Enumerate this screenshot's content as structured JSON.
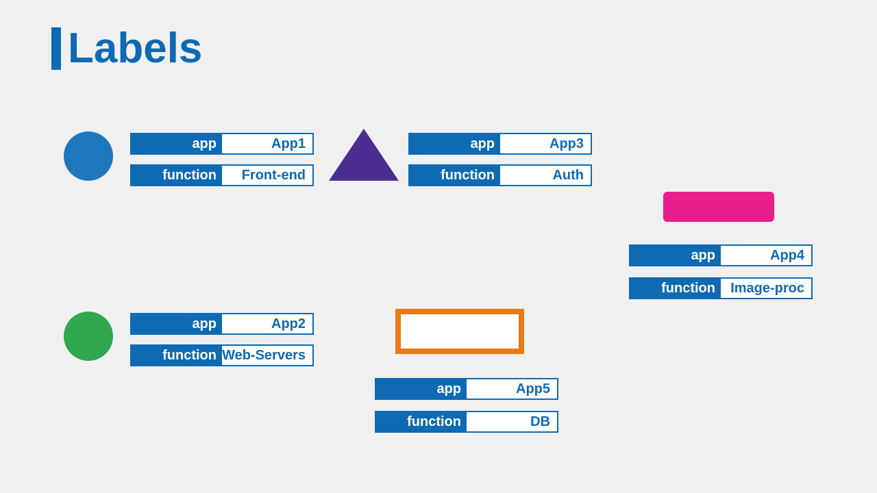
{
  "title": "Labels",
  "keys": {
    "app": "app",
    "function": "function"
  },
  "nodes": [
    {
      "id": "app1",
      "app": "App1",
      "function": "Front-end"
    },
    {
      "id": "app2",
      "app": "App2",
      "function": "Web-Servers"
    },
    {
      "id": "app3",
      "app": "App3",
      "function": "Auth"
    },
    {
      "id": "app4",
      "app": "App4",
      "function": "Image-proc"
    },
    {
      "id": "app5",
      "app": "App5",
      "function": "DB"
    }
  ]
}
